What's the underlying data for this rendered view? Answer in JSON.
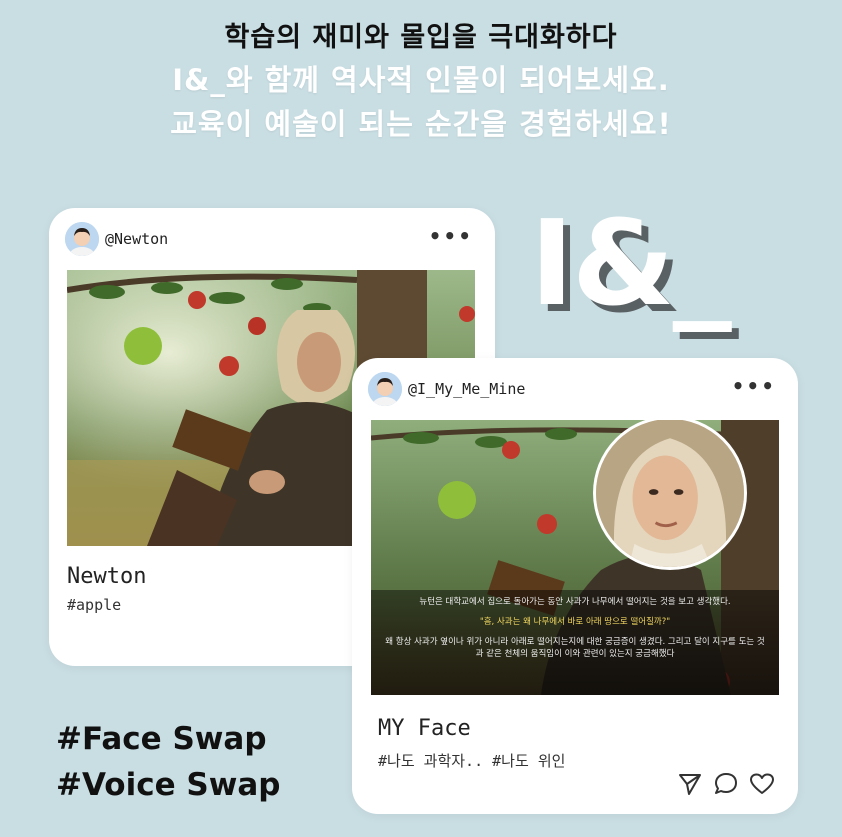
{
  "headline": {
    "line1": "학습의 재미와 몰입을 극대화하다",
    "line2": "I&_와 함께 역사적 인물이 되어보세요.",
    "line3": "교육이 예술이 되는 순간을 경험하세요!"
  },
  "brand": {
    "logo_text": "I&_"
  },
  "post1": {
    "handle": "@Newton",
    "menu_icon": "more-dots-icon",
    "title": "Newton",
    "tags": "#apple"
  },
  "post2": {
    "handle": "@I_My_Me_Mine",
    "menu_icon": "more-dots-icon",
    "title": "MY Face",
    "tags": "#나도 과학자.. #나도 위인",
    "overlay": {
      "p1": "뉴턴은 대학교에서 집으로 돌아가는 동안 사과가 나무에서 떨어지는 것을 보고 생각했다.",
      "p2": "\"흠, 사과는 왜 나무에서 바로 아래 땅으로 떨어질까?\"",
      "p3": "왜 항상 사과가 옆이나 위가 아니라 아래로 떨어지는지에 대한 궁금증이 생겼다. 그리고 달이 지구를 도는 것과 같은 천체의 움직임이 이와 관련이 있는지 궁금해했다"
    },
    "actions": [
      "send-icon",
      "comment-icon",
      "heart-icon"
    ]
  },
  "hashtags": {
    "face": "#Face Swap",
    "voice": "#Voice Swap"
  },
  "colors": {
    "background": "#c9dee3",
    "brand_shadow": "#5a6164",
    "card": "#ffffff"
  }
}
